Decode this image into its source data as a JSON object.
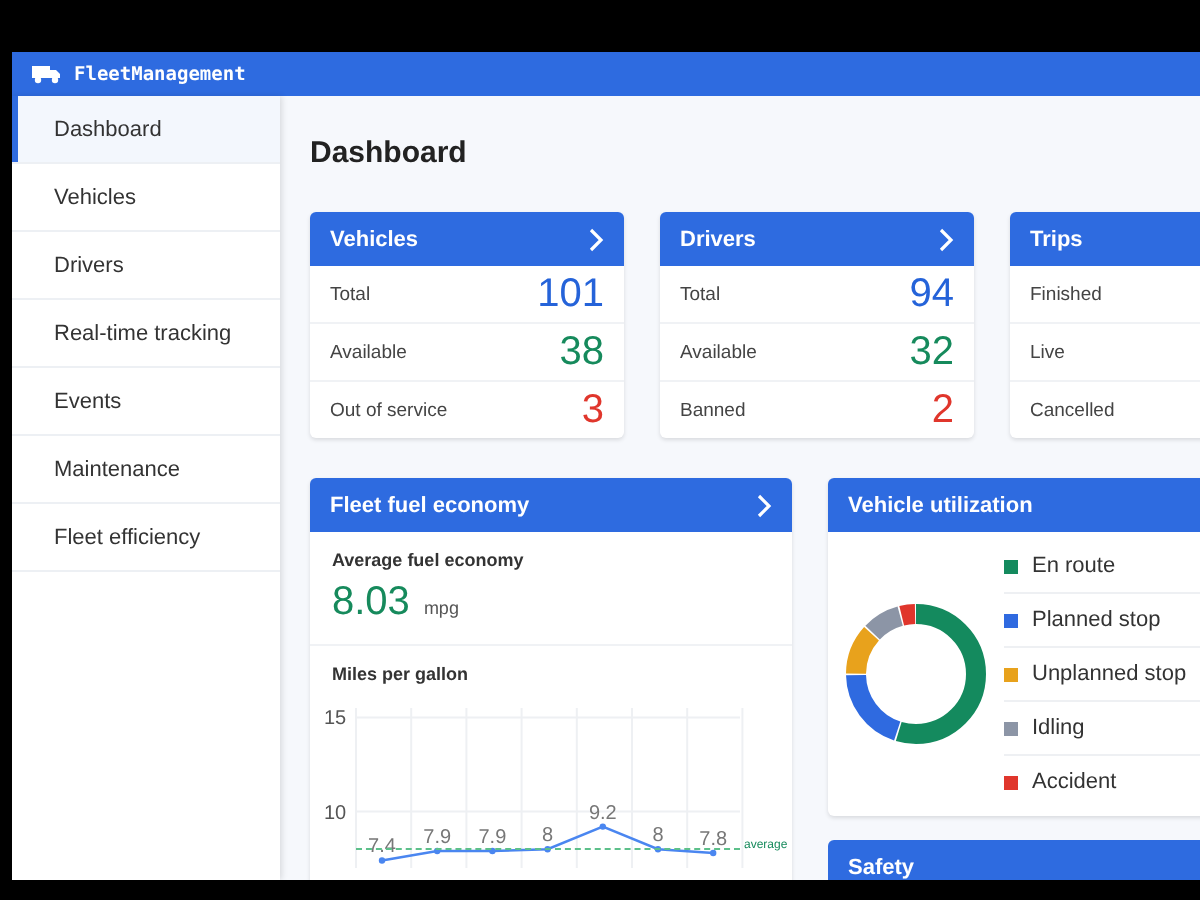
{
  "app": {
    "title": "FleetManagement"
  },
  "sidebar": {
    "items": [
      {
        "label": "Dashboard",
        "selected": true
      },
      {
        "label": "Vehicles",
        "selected": false
      },
      {
        "label": "Drivers",
        "selected": false
      },
      {
        "label": "Real-time tracking",
        "selected": false
      },
      {
        "label": "Events",
        "selected": false
      },
      {
        "label": "Maintenance",
        "selected": false
      },
      {
        "label": "Fleet efficiency",
        "selected": false
      }
    ]
  },
  "page_title": "Dashboard",
  "summary_cards": [
    {
      "title": "Vehicles",
      "rows": [
        {
          "label": "Total",
          "value": "101",
          "color": "#2563d9"
        },
        {
          "label": "Available",
          "value": "38",
          "color": "#168a5c"
        },
        {
          "label": "Out of service",
          "value": "3",
          "color": "#e0362c"
        }
      ]
    },
    {
      "title": "Drivers",
      "rows": [
        {
          "label": "Total",
          "value": "94",
          "color": "#2563d9"
        },
        {
          "label": "Available",
          "value": "32",
          "color": "#168a5c"
        },
        {
          "label": "Banned",
          "value": "2",
          "color": "#e0362c"
        }
      ]
    },
    {
      "title": "Trips",
      "rows": [
        {
          "label": "Finished"
        },
        {
          "label": "Live"
        },
        {
          "label": "Cancelled"
        }
      ]
    }
  ],
  "fuel_card": {
    "title": "Fleet fuel economy",
    "metric_label": "Average fuel economy",
    "metric_value": "8.03",
    "metric_unit": "mpg",
    "average_label": "average",
    "chart_data": {
      "type": "line",
      "title": "Miles per gallon",
      "ylim": [
        7,
        15.5
      ],
      "yticks": [
        10,
        15
      ],
      "values": [
        7.4,
        7.9,
        7.9,
        8,
        9.2,
        8,
        7.8
      ],
      "marker": true,
      "data_labels": true
    }
  },
  "utilization_card": {
    "title": "Vehicle utilization",
    "legend": [
      {
        "label": "En route",
        "color": "#148a5e"
      },
      {
        "label": "Planned stop",
        "color": "#2f6ae0"
      },
      {
        "label": "Unplanned stop",
        "color": "#e8a21c"
      },
      {
        "label": "Idling",
        "color": "#8c95a6"
      },
      {
        "label": "Accident",
        "color": "#e0362c"
      }
    ]
  },
  "safety_card": {
    "title": "Safety"
  }
}
